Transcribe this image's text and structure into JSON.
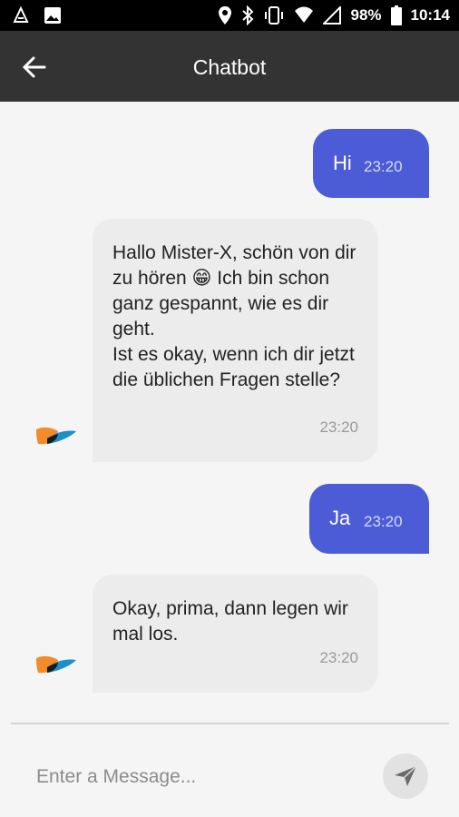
{
  "status_bar": {
    "battery": "98%",
    "time": "10:14"
  },
  "app_bar": {
    "title": "Chatbot"
  },
  "messages": [
    {
      "sender": "user",
      "text": "Hi",
      "time": "23:20"
    },
    {
      "sender": "bot",
      "text": "Hallo Mister-X, schön von dir zu hören 😁 Ich bin schon ganz gespannt, wie es dir geht.\nIst es okay, wenn ich dir jetzt die üblichen Fragen stelle?",
      "time": "23:20"
    },
    {
      "sender": "user",
      "text": "Ja",
      "time": "23:20"
    },
    {
      "sender": "bot",
      "text": "Okay, prima, dann legen wir mal los.",
      "time": "23:20"
    }
  ],
  "composer": {
    "placeholder": "Enter a Message..."
  },
  "colors": {
    "user_bubble": "#4c5cd6",
    "bot_bubble": "#ececec",
    "app_bar": "#333333"
  }
}
